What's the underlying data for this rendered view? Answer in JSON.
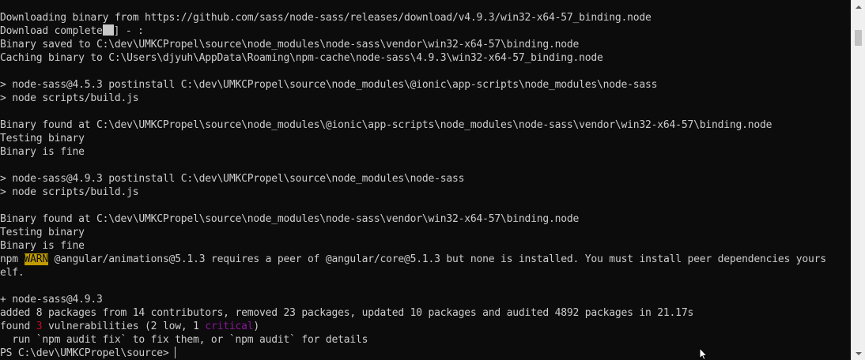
{
  "terminal": {
    "lines": [
      "Downloading binary from https://github.com/sass/node-sass/releases/download/v4.9.3/win32-x64-57_binding.node",
      null,
      "Binary saved to C:\\dev\\UMKCPropel\\source\\node_modules\\node-sass\\vendor\\win32-x64-57\\binding.node",
      "Caching binary to C:\\Users\\djyuh\\AppData\\Roaming\\npm-cache\\node-sass\\4.9.3\\win32-x64-57_binding.node",
      "",
      "> node-sass@4.5.3 postinstall C:\\dev\\UMKCPropel\\source\\node_modules\\@ionic\\app-scripts\\node_modules\\node-sass",
      "> node scripts/build.js",
      "",
      "Binary found at C:\\dev\\UMKCPropel\\source\\node_modules\\@ionic\\app-scripts\\node_modules\\node-sass\\vendor\\win32-x64-57\\binding.node",
      "Testing binary",
      "Binary is fine",
      "",
      "> node-sass@4.9.3 postinstall C:\\dev\\UMKCPropel\\source\\node_modules\\node-sass",
      "> node scripts/build.js",
      "",
      "Binary found at C:\\dev\\UMKCPropel\\source\\node_modules\\node-sass\\vendor\\win32-x64-57\\binding.node",
      "Testing binary",
      "Binary is fine",
      null,
      "elf.",
      "",
      "+ node-sass@4.9.3",
      "added 8 packages from 14 contributors, removed 23 packages, updated 10 packages and audited 4892 packages in 21.17s",
      null,
      "  run `npm audit fix` to fix them, or `npm audit` for details",
      null
    ],
    "download_complete": {
      "before": "Download complete",
      "after": "] - :"
    },
    "npm_warn": {
      "prefix": "npm ",
      "tag": "WARN",
      "message": " @angular/animations@5.1.3 requires a peer of @angular/core@5.1.3 but none is installed. You must install peer dependencies yours"
    },
    "audit": {
      "prefix": "found ",
      "count": "3",
      "mid1": " vulnerabilities (2 ",
      "low": "low",
      "mid2": ", 1 ",
      "critical": "critical",
      "suffix": ")"
    },
    "prompt": "PS C:\\dev\\UMKCPropel\\source> "
  },
  "colors": {
    "background": "#0c0c0c",
    "foreground": "#cccccc",
    "warn_bg": "#c19c00",
    "vuln_count": "#c50f1f",
    "critical": "#881798"
  },
  "icons": {
    "scroll_up": "up-arrow-icon",
    "scroll_down": "down-arrow-icon",
    "pointer": "mouse-pointer-icon"
  }
}
